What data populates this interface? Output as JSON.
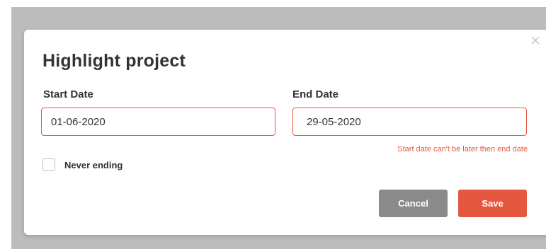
{
  "modal": {
    "title": "Highlight project",
    "close_icon": "close-icon"
  },
  "form": {
    "start_date": {
      "label": "Start Date",
      "value": "01-06-2020"
    },
    "end_date": {
      "label": "End Date",
      "value": "29-05-2020"
    },
    "error_message": "Start date can't be later then end date",
    "never_ending": {
      "label": "Never ending",
      "checked": false
    }
  },
  "buttons": {
    "cancel_label": "Cancel",
    "save_label": "Save"
  },
  "colors": {
    "accent": "#e5583f",
    "cancel": "#8a8a8a",
    "backdrop": "#bcbcbc",
    "text": "#333333"
  }
}
